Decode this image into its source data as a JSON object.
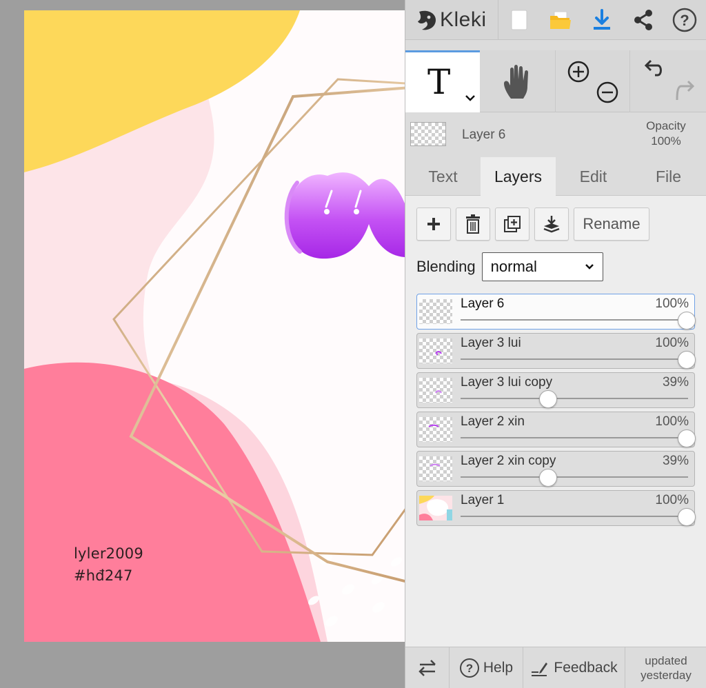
{
  "canvas": {
    "watermark_line1": "lyler2009",
    "watermark_line2": "#hđ247",
    "colors": {
      "yellow": "#fdd85a",
      "pink": "#ff7e9b",
      "blush": "#fde4e8",
      "gold": "#c89a6a",
      "purple": "#b63df0"
    }
  },
  "app": {
    "logo_text": "Kleki",
    "toolbar_icons": [
      "new-image-icon",
      "open-folder-icon",
      "download-icon",
      "share-icon",
      "help-icon"
    ]
  },
  "tools": {
    "text_tool_glyph": "T",
    "hand_icon": "hand-icon",
    "zoom_in_icon": "zoom-in-icon",
    "zoom_out_icon": "zoom-out-icon",
    "undo_icon": "undo-icon",
    "redo_icon": "redo-icon"
  },
  "current_layer": {
    "name": "Layer 6",
    "opacity_label": "Opacity",
    "opacity_value": "100%"
  },
  "tabs": [
    {
      "label": "Text",
      "active": false
    },
    {
      "label": "Layers",
      "active": true
    },
    {
      "label": "Edit",
      "active": false
    },
    {
      "label": "File",
      "active": false
    }
  ],
  "layer_panel": {
    "rename_label": "Rename",
    "blending_label": "Blending",
    "blending_value": "normal",
    "layers": [
      {
        "name": "Layer 6",
        "opacity": "100%",
        "value": 1.0,
        "active": true
      },
      {
        "name": "Layer 3 lui",
        "opacity": "100%",
        "value": 1.0,
        "active": false
      },
      {
        "name": "Layer 3 lui copy",
        "opacity": "39%",
        "value": 0.39,
        "active": false
      },
      {
        "name": "Layer 2 xin",
        "opacity": "100%",
        "value": 1.0,
        "active": false
      },
      {
        "name": "Layer 2 xin copy",
        "opacity": "39%",
        "value": 0.39,
        "active": false
      },
      {
        "name": "Layer 1",
        "opacity": "100%",
        "value": 1.0,
        "active": false
      }
    ]
  },
  "footer": {
    "help_label": "Help",
    "feedback_label": "Feedback",
    "updated_line1": "updated",
    "updated_line2": "yesterday"
  }
}
